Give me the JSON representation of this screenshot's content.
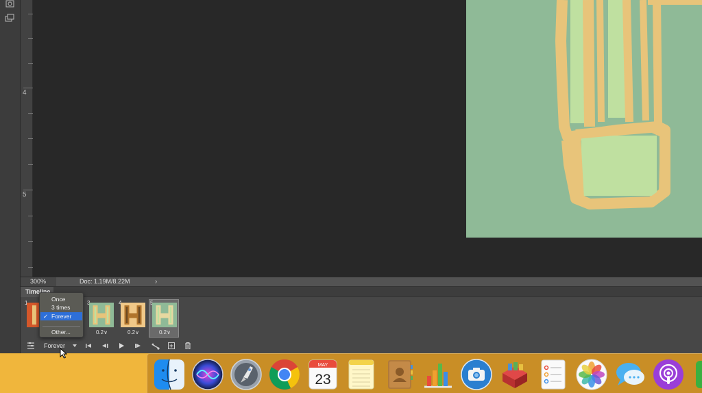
{
  "ruler": {
    "marks": [
      "4",
      "5"
    ]
  },
  "status": {
    "zoom": "300%",
    "doc": "Doc: 1.19M/8.22M",
    "arrow": "›"
  },
  "timeline": {
    "title": "Timeline",
    "frames": [
      {
        "number": "1",
        "delay": ""
      },
      {
        "number": "3",
        "delay": "0.2∨"
      },
      {
        "number": "4",
        "delay": "0.2∨"
      },
      {
        "number": "5",
        "delay": "0.2∨"
      }
    ],
    "loop_value": "Forever",
    "loop_menu": [
      {
        "label": "Once",
        "checked": false
      },
      {
        "label": "3 times",
        "checked": false
      },
      {
        "label": "Forever",
        "checked": true
      },
      {
        "label": "Other...",
        "checked": false
      }
    ],
    "check_glyph": "✓"
  },
  "dock": {
    "calendar_month": "MAY",
    "calendar_day": "23",
    "icons": [
      "finder-icon",
      "siri-icon",
      "launchpad-icon",
      "chrome-icon",
      "calendar-icon",
      "notes-icon",
      "contacts-icon",
      "numbers-icon",
      "screenshot-icon",
      "toolbox-icon",
      "reminders-icon",
      "photos-icon",
      "messages-icon",
      "podcasts-icon"
    ]
  },
  "colors": {
    "canvas_green": "#8fba97",
    "stroke_tan": "#e8c47a",
    "fill_lightgreen": "#bfe0a0",
    "dock_bg": "#f0b63c",
    "menu_highlight": "#2e6fd8"
  }
}
